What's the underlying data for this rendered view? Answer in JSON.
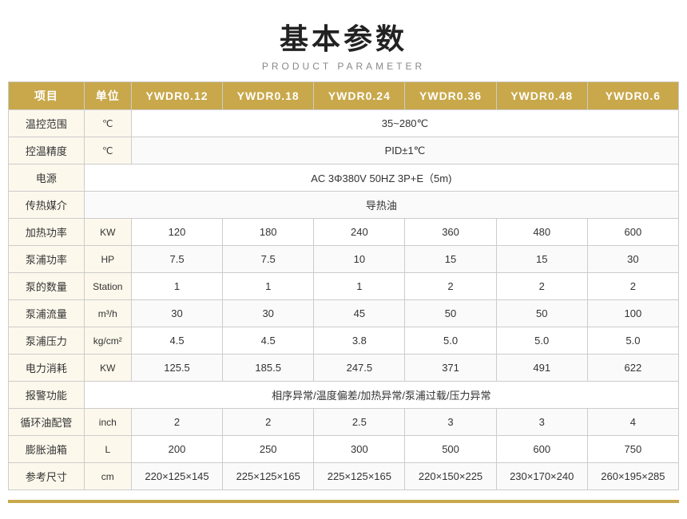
{
  "title": {
    "main": "基本参数",
    "sub": "PRODUCT PARAMETER"
  },
  "table": {
    "headers": [
      "项目",
      "单位",
      "YWDR0.12",
      "YWDR0.18",
      "YWDR0.24",
      "YWDR0.36",
      "YWDR0.48",
      "YWDR0.6"
    ],
    "rows": [
      {
        "label": "温控范围",
        "unit": "℃",
        "values": [
          "35~280℃"
        ],
        "span": 6
      },
      {
        "label": "控温精度",
        "unit": "℃",
        "values": [
          "PID±1℃"
        ],
        "span": 6
      },
      {
        "label": "电源",
        "unit": "",
        "values": [
          "AC 3Φ380V 50HZ 3P+E（5m)"
        ],
        "span": 7
      },
      {
        "label": "传热媒介",
        "unit": "",
        "values": [
          "导热油"
        ],
        "span": 7
      },
      {
        "label": "加热功率",
        "unit": "KW",
        "values": [
          "120",
          "180",
          "240",
          "360",
          "480",
          "600"
        ],
        "span": 0
      },
      {
        "label": "泵浦功率",
        "unit": "HP",
        "values": [
          "7.5",
          "7.5",
          "10",
          "15",
          "15",
          "30"
        ],
        "span": 0
      },
      {
        "label": "泵的数量",
        "unit": "Station",
        "values": [
          "1",
          "1",
          "1",
          "2",
          "2",
          "2"
        ],
        "span": 0
      },
      {
        "label": "泵浦流量",
        "unit": "m³/h",
        "values": [
          "30",
          "30",
          "45",
          "50",
          "50",
          "100"
        ],
        "span": 0
      },
      {
        "label": "泵浦压力",
        "unit": "kg/cm²",
        "values": [
          "4.5",
          "4.5",
          "3.8",
          "5.0",
          "5.0",
          "5.0"
        ],
        "span": 0
      },
      {
        "label": "电力消耗",
        "unit": "KW",
        "values": [
          "125.5",
          "185.5",
          "247.5",
          "371",
          "491",
          "622"
        ],
        "span": 0
      },
      {
        "label": "报警功能",
        "unit": "",
        "values": [
          "相序异常/温度偏差/加热异常/泵浦过载/压力异常"
        ],
        "span": 7
      },
      {
        "label": "循环油配管",
        "unit": "inch",
        "values": [
          "2",
          "2",
          "2.5",
          "3",
          "3",
          "4"
        ],
        "span": 0
      },
      {
        "label": "膨胀油箱",
        "unit": "L",
        "values": [
          "200",
          "250",
          "300",
          "500",
          "600",
          "750"
        ],
        "span": 0
      },
      {
        "label": "参考尺寸",
        "unit": "cm",
        "values": [
          "220×125×145",
          "225×125×165",
          "225×125×165",
          "220×150×225",
          "230×170×240",
          "260×195×285"
        ],
        "span": 0
      }
    ]
  }
}
